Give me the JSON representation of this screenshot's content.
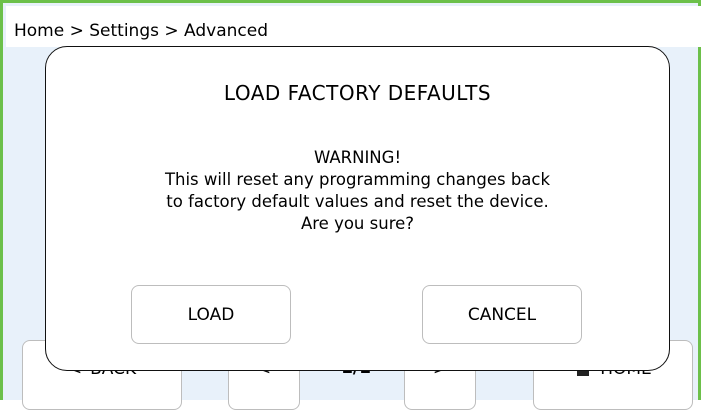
{
  "breadcrumb": "Home > Settings > Advanced",
  "colors": {
    "frame_border": "#6cc04a",
    "background": "#e8f1fa",
    "dialog_border": "#111111"
  },
  "nav": {
    "back_label": "BACK",
    "page": "1/1",
    "home_label": "HOME",
    "icons": {
      "back": "chevron-left-icon",
      "prev": "chevron-left-icon",
      "next": "chevron-right-icon",
      "home": "home-icon"
    }
  },
  "dialog": {
    "title": "LOAD FACTORY DEFAULTS",
    "message_lines": [
      "WARNING!",
      "This will reset any programming changes back",
      "to factory default values and reset the device.",
      "Are you sure?"
    ],
    "load_label": "LOAD",
    "cancel_label": "CANCEL"
  }
}
